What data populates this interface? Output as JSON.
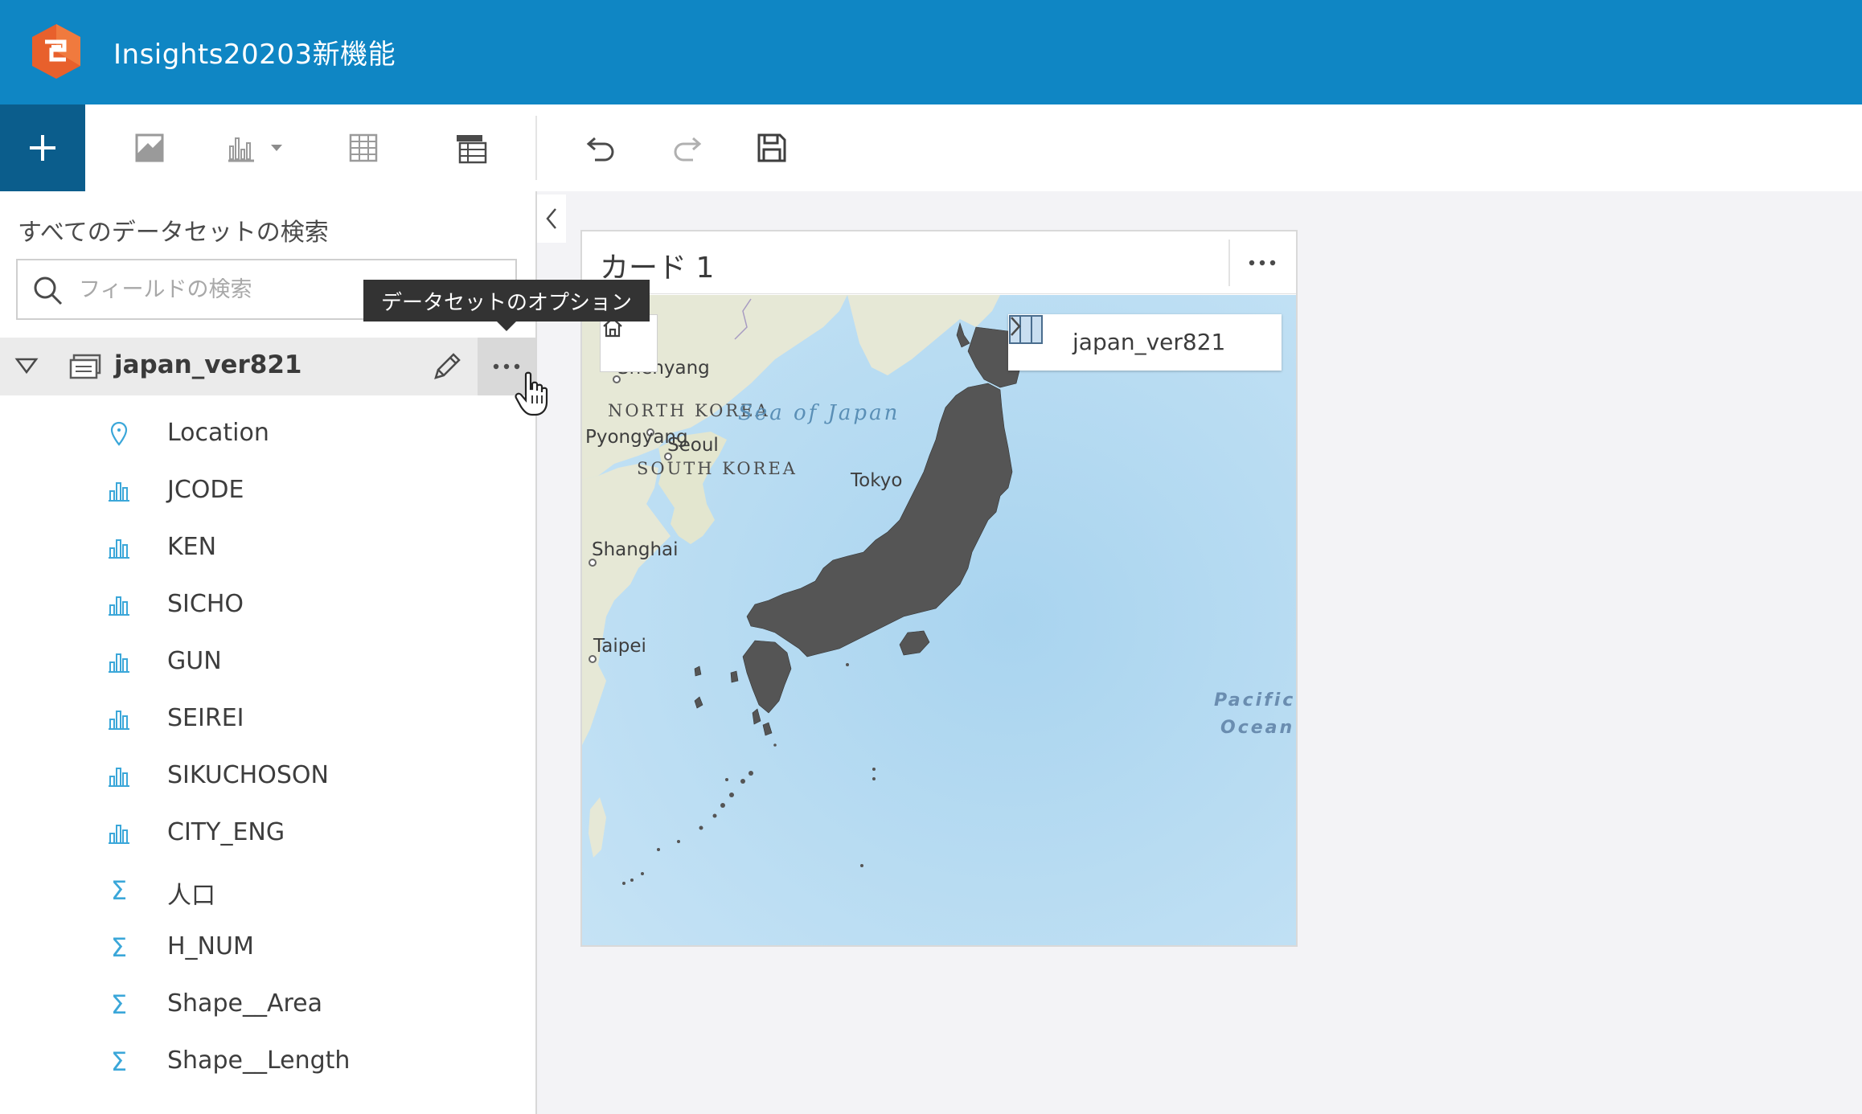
{
  "app": {
    "title": "Insights20203新機能"
  },
  "toolbar": {
    "add": "add-icon",
    "tools": [
      "map-icon",
      "chart-icon",
      "table-icon",
      "summary-table-icon",
      "undo-icon",
      "redo-icon",
      "save-icon"
    ]
  },
  "panel": {
    "heading": "すべてのデータセットの検索",
    "search_placeholder": "フィールドの検索",
    "tooltip": "データセットのオプション",
    "dataset": {
      "name": "japan_ver821"
    },
    "fields": [
      {
        "label": "Location",
        "type": "location"
      },
      {
        "label": "JCODE",
        "type": "string"
      },
      {
        "label": "KEN",
        "type": "string"
      },
      {
        "label": "SICHO",
        "type": "string"
      },
      {
        "label": "GUN",
        "type": "string"
      },
      {
        "label": "SEIREI",
        "type": "string"
      },
      {
        "label": "SIKUCHOSON",
        "type": "string"
      },
      {
        "label": "CITY_ENG",
        "type": "string"
      },
      {
        "label": "人口",
        "type": "number"
      },
      {
        "label": "H_NUM",
        "type": "number"
      },
      {
        "label": "Shape__Area",
        "type": "number"
      },
      {
        "label": "Shape__Length",
        "type": "number"
      }
    ]
  },
  "card": {
    "title": "カード 1",
    "layer": "japan_ver821",
    "map_labels": {
      "shenyang": "Shenyang",
      "north_korea": "NORTH KOREA",
      "sea_of_japan": "Sea of Japan",
      "pyongyang": "Pyongyang",
      "seoul": "Seoul",
      "south_korea": "SOUTH KOREA",
      "tokyo": "Tokyo",
      "shanghai": "Shanghai",
      "taipei": "Taipei",
      "pacific": "Pacific",
      "ocean": "Ocean"
    }
  },
  "colors": {
    "header": "#0f86c4",
    "add_button": "#0b5d8c",
    "field_icon": "#3ba7d9",
    "sea": "#b9dcf2",
    "land": "#e6e8d6"
  }
}
